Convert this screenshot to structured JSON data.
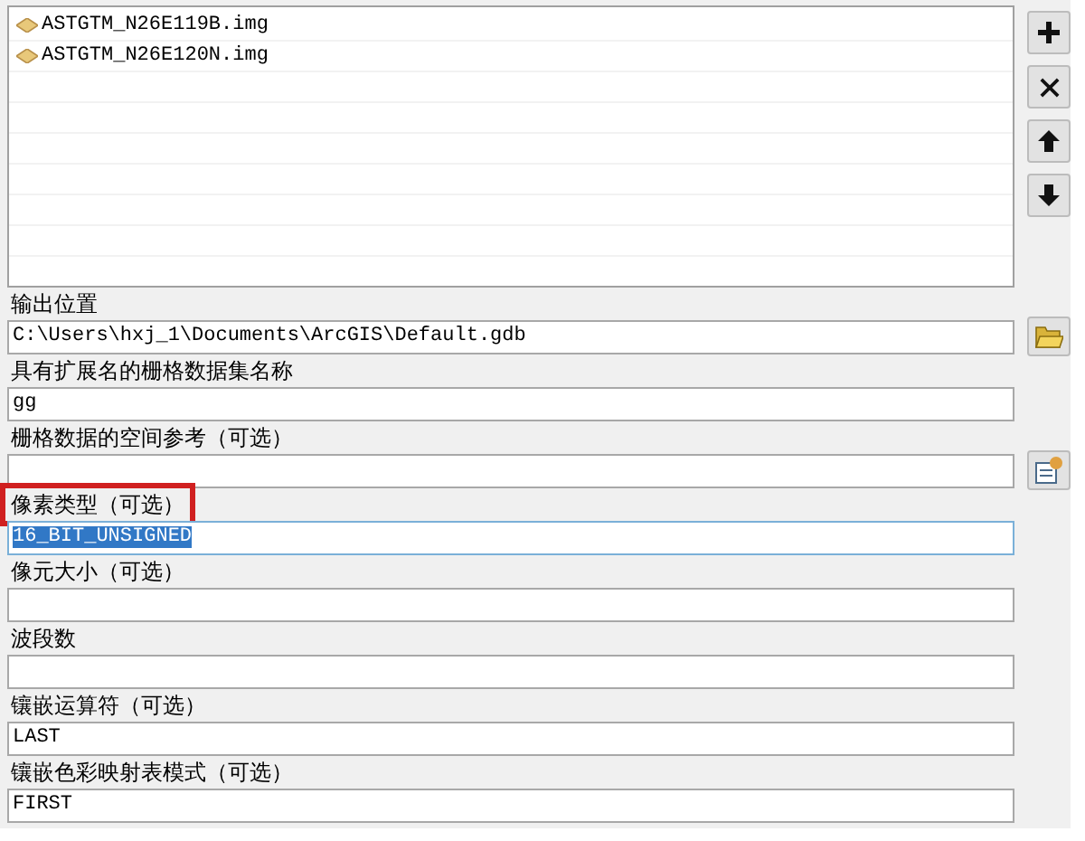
{
  "file_list": {
    "items": [
      {
        "name": "ASTGTM_N26E119B.img"
      },
      {
        "name": "ASTGTM_N26E120N.img"
      }
    ]
  },
  "list_buttons": [
    {
      "kind": "add"
    },
    {
      "kind": "remove"
    },
    {
      "kind": "up"
    },
    {
      "kind": "down"
    }
  ],
  "parameters": [
    {
      "label": "输出位置",
      "value": "C:\\Users\\hxj_1\\Documents\\ArcGIS\\Default.gdb",
      "side_button": {
        "kind": "folder"
      }
    },
    {
      "label": "具有扩展名的栅格数据集名称",
      "value": "gg"
    },
    {
      "label": "栅格数据的空间参考（可选）",
      "side_button": {
        "kind": "properties"
      }
    },
    {
      "label": "像素类型（可选）",
      "value": "16_BIT_UNSIGNED",
      "highlighted": true,
      "value_selected": true
    },
    {
      "label": "像元大小（可选）"
    },
    {
      "label": "波段数"
    },
    {
      "label": "镶嵌运算符（可选）",
      "value": "LAST"
    },
    {
      "label": "镶嵌色彩映射表模式（可选）",
      "value": "FIRST"
    }
  ]
}
